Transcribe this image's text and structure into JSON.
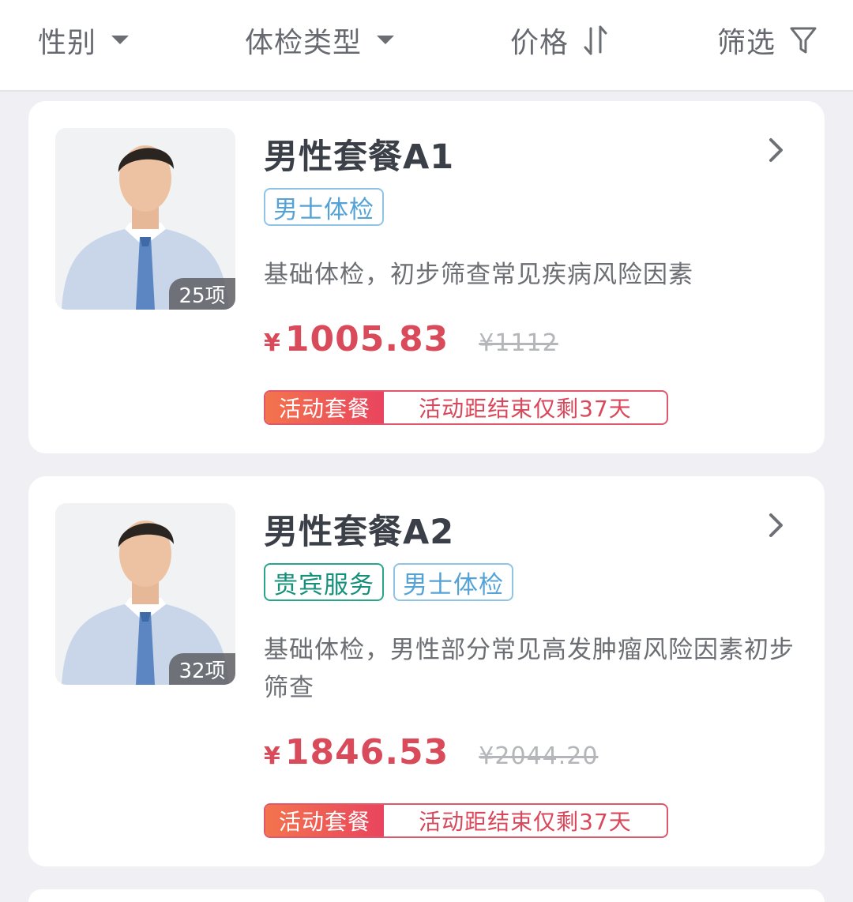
{
  "filters": [
    {
      "label": "性别",
      "icon": "dropdown-caret-icon"
    },
    {
      "label": "体检类型",
      "icon": "dropdown-caret-icon"
    },
    {
      "label": "价格",
      "icon": "sort-arrows-icon"
    },
    {
      "label": "筛选",
      "icon": "funnel-icon"
    }
  ],
  "packages": [
    {
      "title": "男性套餐A1",
      "items_count": "25项",
      "tags": [
        "男士体检"
      ],
      "description": "基础体检，初步筛查常见疾病风险因素",
      "price_symbol": "¥",
      "price": "1005.83",
      "original_price": "¥1112",
      "promo_label": "活动套餐",
      "promo_text": "活动距结束仅剩37天"
    },
    {
      "title": "男性套餐A2",
      "items_count": "32项",
      "tags": [
        "贵宾服务",
        "男士体检"
      ],
      "description": "基础体检，男性部分常见高发肿瘤风险因素初步筛查",
      "price_symbol": "¥",
      "price": "1846.53",
      "original_price": "¥2044.20",
      "promo_label": "活动套餐",
      "promo_text": "活动距结束仅剩37天"
    }
  ],
  "colors": {
    "accent_price": "#d94a5a",
    "tag_blue": "#55a3d6",
    "tag_green": "#15917b",
    "promo_gradient_start": "#f3744d",
    "promo_gradient_end": "#e9445e"
  }
}
